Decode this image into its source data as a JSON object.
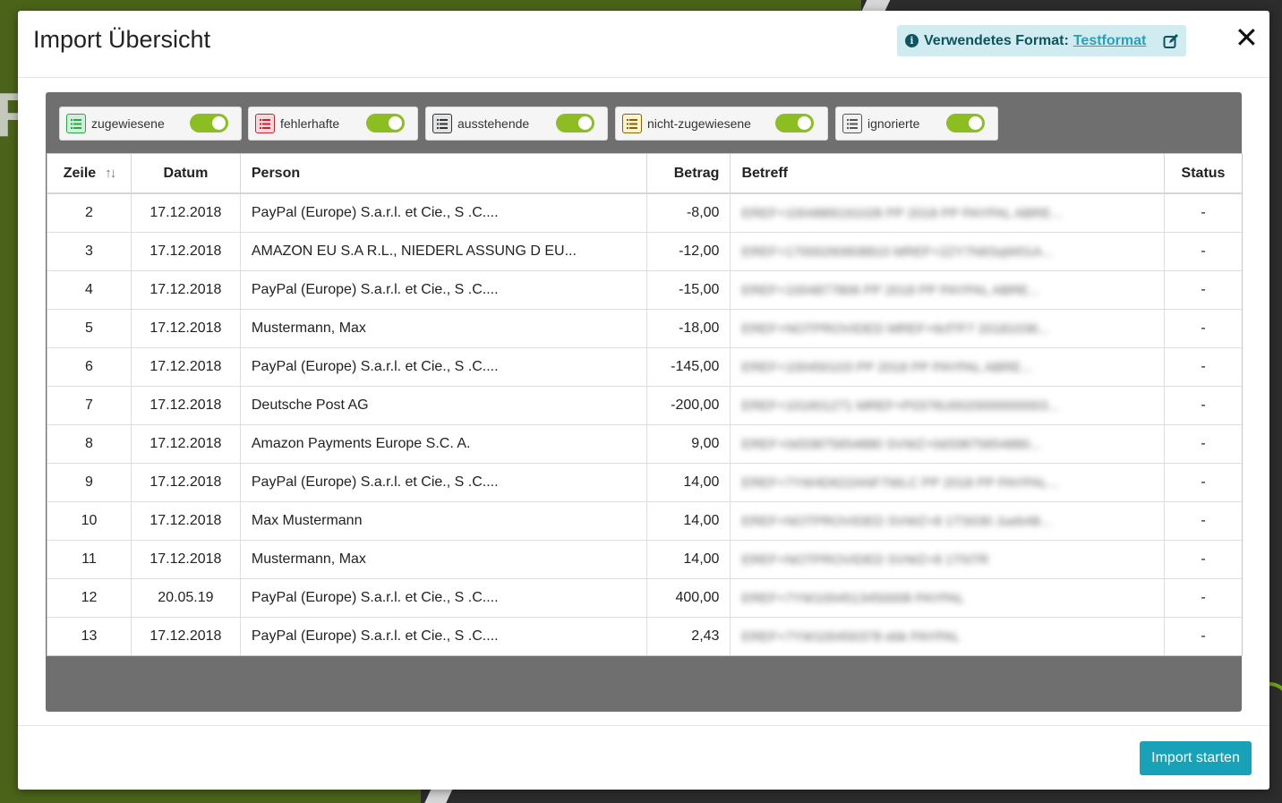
{
  "modal": {
    "title": "Import Übersicht",
    "format_label": "Verwendetes Format:",
    "format_name": "Testformat",
    "close_symbol": "✕",
    "import_button": "Import starten"
  },
  "background": {
    "letter": "R"
  },
  "filters": [
    {
      "label": "zugewiesene",
      "icon": "list-icon",
      "color": "#28a745",
      "bg": "#d4edda",
      "enabled": true
    },
    {
      "label": "fehlerhafte",
      "icon": "list-icon",
      "color": "#c82333",
      "bg": "#f8d7da",
      "enabled": true
    },
    {
      "label": "ausstehende",
      "icon": "list-icon",
      "color": "#333333",
      "bg": "#e2e3e5",
      "enabled": true
    },
    {
      "label": "nicht-zugewiesene",
      "icon": "list-icon",
      "color": "#856404",
      "bg": "#fff3cd",
      "enabled": true
    },
    {
      "label": "ignorierte",
      "icon": "list-icon",
      "color": "#555555",
      "bg": "#f0f0f0",
      "enabled": true
    }
  ],
  "table": {
    "headers": {
      "zeile": "Zeile",
      "datum": "Datum",
      "person": "Person",
      "betrag": "Betrag",
      "betreff": "Betreff",
      "status": "Status"
    },
    "sort_symbol": "↑↓",
    "rows": [
      {
        "zeile": "2",
        "datum": "17.12.2018",
        "person": "PayPal (Europe) S.a.r.l. et Cie., S .C....",
        "betrag": "-8,00",
        "betreff": "EREF+1004889191028 PP 2018 PP PAYPAL ABRE...",
        "status": "-"
      },
      {
        "zeile": "3",
        "datum": "17.12.2018",
        "person": "AMAZON EU S.A R.L., NIEDERL ASSUNG D EU...",
        "betrag": "-12,00",
        "betreff": "EREF+17000260608810 MREF+2ZY7N6SqW01A...",
        "status": "-"
      },
      {
        "zeile": "4",
        "datum": "17.12.2018",
        "person": "PayPal (Europe) S.a.r.l. et Cie., S .C....",
        "betrag": "-15,00",
        "betreff": "EREF+1004877806 PP 2018 PP PAYPAL ABRE...",
        "status": "-"
      },
      {
        "zeile": "5",
        "datum": "17.12.2018",
        "person": "Mustermann, Max",
        "betrag": "-18,00",
        "betreff": "EREF+NOTPROVIDED MREF+6cf7F7 20181036...",
        "status": "-"
      },
      {
        "zeile": "6",
        "datum": "17.12.2018",
        "person": "PayPal (Europe) S.a.r.l. et Cie., S .C....",
        "betrag": "-145,00",
        "betreff": "EREF+100450103 PP 2018 PP PAYPAL ABRE...",
        "status": "-"
      },
      {
        "zeile": "7",
        "datum": "17.12.2018",
        "person": "Deutsche Post AG",
        "betrag": "-200,00",
        "betreff": "EREF+101601271 MREF+P0376U0020000000003...",
        "status": "-"
      },
      {
        "zeile": "8",
        "datum": "17.12.2018",
        "person": "Amazon Payments Europe S.C. A.",
        "betrag": "9,00",
        "betreff": "EREF+0d33875654880 SVWZ+0d33875654880...",
        "status": "-"
      },
      {
        "zeile": "9",
        "datum": "17.12.2018",
        "person": "PayPal (Europe) S.a.r.l. et Cie., S .C....",
        "betrag": "14,00",
        "betreff": "EREF+7YW4D622ANF7WLC PP 2018 PP PAYPAL...",
        "status": "-"
      },
      {
        "zeile": "10",
        "datum": "17.12.2018",
        "person": "Max Mustermann",
        "betrag": "14,00",
        "betreff": "EREF+NOTPROVIDED SVWZ+8 1TS030 Jueb48...",
        "status": "-"
      },
      {
        "zeile": "11",
        "datum": "17.12.2018",
        "person": "Mustermann, Max",
        "betrag": "14,00",
        "betreff": "EREF+NOTPROVIDED SVWZ+8 1TNTR",
        "status": "-"
      },
      {
        "zeile": "12",
        "datum": "20.05.19",
        "person": "PayPal (Europe) S.a.r.l. et Cie., S .C....",
        "betrag": "400,00",
        "betreff": "EREF+7YW1004513450008 PAYPAL",
        "status": "-"
      },
      {
        "zeile": "13",
        "datum": "17.12.2018",
        "person": "PayPal (Europe) S.a.r.l. et Cie., S .C....",
        "betrag": "2,43",
        "betreff": "EREF+7YW100450378 ebk PAYPAL",
        "status": "-"
      }
    ]
  }
}
